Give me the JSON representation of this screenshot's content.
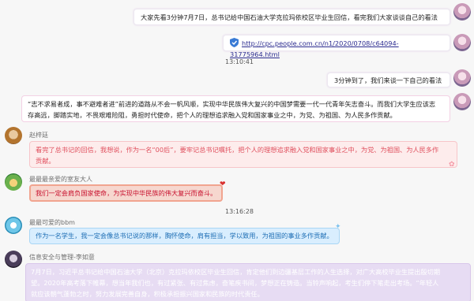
{
  "messages": [
    {
      "text": "大家先看3分钟7月7日，总书记给中国石油大学克拉玛依校区毕业生回信，看完我们大家谈谈自己的看法"
    },
    {
      "link": "http://cpc.people.com.cn/n1/2020/0708/c64094-31775964.html"
    },
    {
      "time": "13:10:41"
    },
    {
      "text": "3分钟到了，我们来谈一下自己的看法"
    },
    {
      "text_lines": [
        "“志不求易者成，事不避难者进”前进的道路从不会一帆风顺，实现中华民族伟大复兴的中国梦需要一代一代青年矢志奋斗。而我们大学生应该志",
        "存高远，脚踏实地，不畏艰难险阻，勇担时代使命，把个人的理想追求融入党和国家事业之中，为党、为祖国、为人民多作贡献。"
      ]
    },
    {
      "name": "赵梓廷",
      "text_lines": [
        "看完了总书记的回信，我想说，作为一名“00后”，要牢记总书记嘱托，把个人的理想追求融入党和国家事业之中，为党、为祖国、为人民多作",
        "贡献。"
      ]
    },
    {
      "name": "最最最亲爱的室友大人",
      "text": "我们一定会肩负国家使命，为实现中华民族的伟大复兴而奋斗。"
    },
    {
      "time": "13:16:28"
    },
    {
      "name": "最最可爱的bbm",
      "text": "作为一名学生，我一定会像总书记说的那样，胸怀使命，肩有担当，学以致用，为祖国的事业多作贡献。"
    },
    {
      "name": "信息安全与管理-李如意",
      "text_lines": [
        "7月7日，习近平总书记给中国石油大学（北京）克拉玛依校区毕业生回信，肯定他们到边疆基层工作的人生选择，对广大高校毕业生提出殷切期",
        "望。2020年高考落下帷幕，想当年我们也，有过紧张、有过焦虑，奋笔疾书间，梦想正在铸造。当铃声响起，考生们停下笔走出考场。“年轻人",
        "就应该朝气蓬勃之时，努力发展完善自身，积极承担振兴国家和民族的时代责任。"
      ]
    }
  ],
  "colors": {
    "pink_text": "#e0505e",
    "red_text": "#c8102e",
    "blue_text": "#1f6fb5"
  }
}
